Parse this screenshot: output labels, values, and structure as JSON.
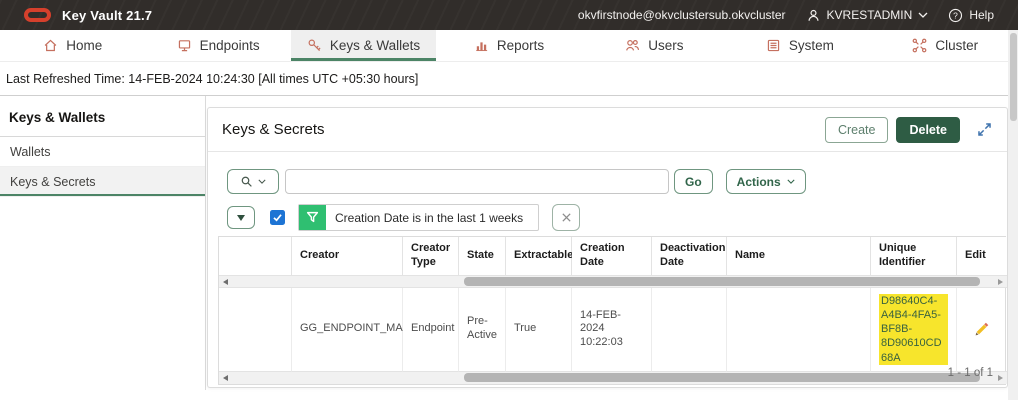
{
  "colors": {
    "topbar_bg": "#312d2a",
    "logo_red": "#d5402c",
    "nav_icon_salmon": "#c5705f",
    "accent_green_underline": "#4c8466",
    "button_green_border": "#6f9680",
    "button_green_text": "#31654a",
    "delete_button_bg": "#2e5c44",
    "filter_funnel_green": "#2fbf71",
    "checkbox_blue": "#1d74d4",
    "highlight_yellow": "#f7e52c",
    "expand_icon_blue": "#3f73ad"
  },
  "topbar": {
    "product": "Key Vault 21.7",
    "node": "okvfirstnode@okvclustersub.okvcluster",
    "user": "KVRESTADMIN",
    "help_label": "Help"
  },
  "nav": {
    "items": [
      {
        "label": "Home",
        "icon": "home-icon",
        "active": false
      },
      {
        "label": "Endpoints",
        "icon": "endpoints-icon",
        "active": false
      },
      {
        "label": "Keys & Wallets",
        "icon": "key-icon",
        "active": true
      },
      {
        "label": "Reports",
        "icon": "reports-icon",
        "active": false
      },
      {
        "label": "Users",
        "icon": "users-icon",
        "active": false
      },
      {
        "label": "System",
        "icon": "system-icon",
        "active": false
      },
      {
        "label": "Cluster",
        "icon": "cluster-icon",
        "active": false
      }
    ]
  },
  "status_bar": {
    "last_refreshed": "Last Refreshed Time: 14-FEB-2024 10:24:30 [All times UTC +05:30 hours]"
  },
  "sidebar": {
    "title": "Keys & Wallets",
    "items": [
      {
        "label": "Wallets",
        "selected": false
      },
      {
        "label": "Keys & Secrets",
        "selected": true
      }
    ]
  },
  "panel": {
    "title": "Keys & Secrets",
    "create_label": "Create",
    "delete_label": "Delete"
  },
  "toolbar": {
    "search_value": "",
    "go_label": "Go",
    "actions_label": "Actions"
  },
  "filter": {
    "checked": true,
    "text": "Creation Date is in the last 1 weeks"
  },
  "table": {
    "columns": [
      "",
      "Creator",
      "Creator Type",
      "State",
      "Extractable",
      "Creation Date",
      "Deactivation Date",
      "Name",
      "Unique Identifier",
      "Edit"
    ],
    "rows": [
      {
        "creator": "GG_ENDPOINT_MA",
        "creator_type": "Endpoint",
        "state": "Pre-Active",
        "extractable": "True",
        "creation_date": "14-FEB-2024 10:22:03",
        "deactivation_date": "",
        "name": "",
        "unique_identifier": "D98640C4-A4B4-4FA5-BF8B-8D90610CD68A"
      }
    ],
    "pagination": "1 - 1 of 1"
  }
}
